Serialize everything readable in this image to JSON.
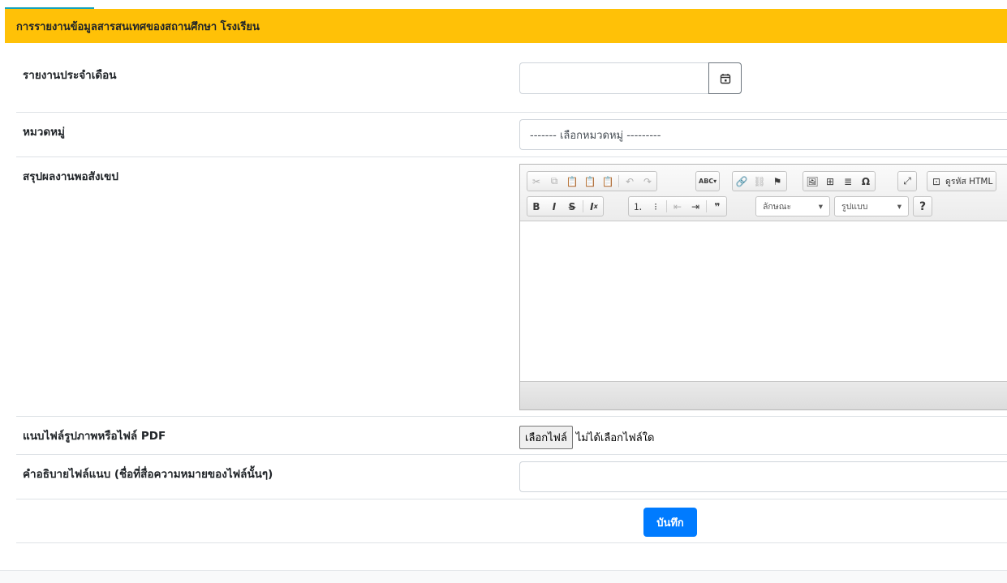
{
  "header": {
    "title": "การรายงานข้อมูลสารสนเทศของสถานศึกษา โรงเรียน"
  },
  "form": {
    "report_month": {
      "label": "รายงานประจำเดือน",
      "value": ""
    },
    "category": {
      "label": "หมวดหมู่",
      "selected": "------- เลือกหมวดหมู่ ---------"
    },
    "summary": {
      "label": "สรุปผลงานพอสังเขป",
      "source_label": "ดูรหัส HTML",
      "styles_combo": "ลักษณะ",
      "format_combo": "รูปแบบ",
      "help": "?",
      "spell": "ABC",
      "content": ""
    },
    "attachment": {
      "label": "แนบไฟล์รูปภาพหรือไฟล์ PDF",
      "button": "เลือกไฟล์",
      "status": "ไม่ได้เลือกไฟล์ใด"
    },
    "description": {
      "label": "คำอธิบายไฟล์แนบ (ชื่อที่สื่อความหมายของไฟล์นั้นๆ)",
      "value": ""
    },
    "submit_label": "บันทึก"
  },
  "colors": {
    "header_bg": "#ffc107",
    "primary": "#007bff"
  }
}
